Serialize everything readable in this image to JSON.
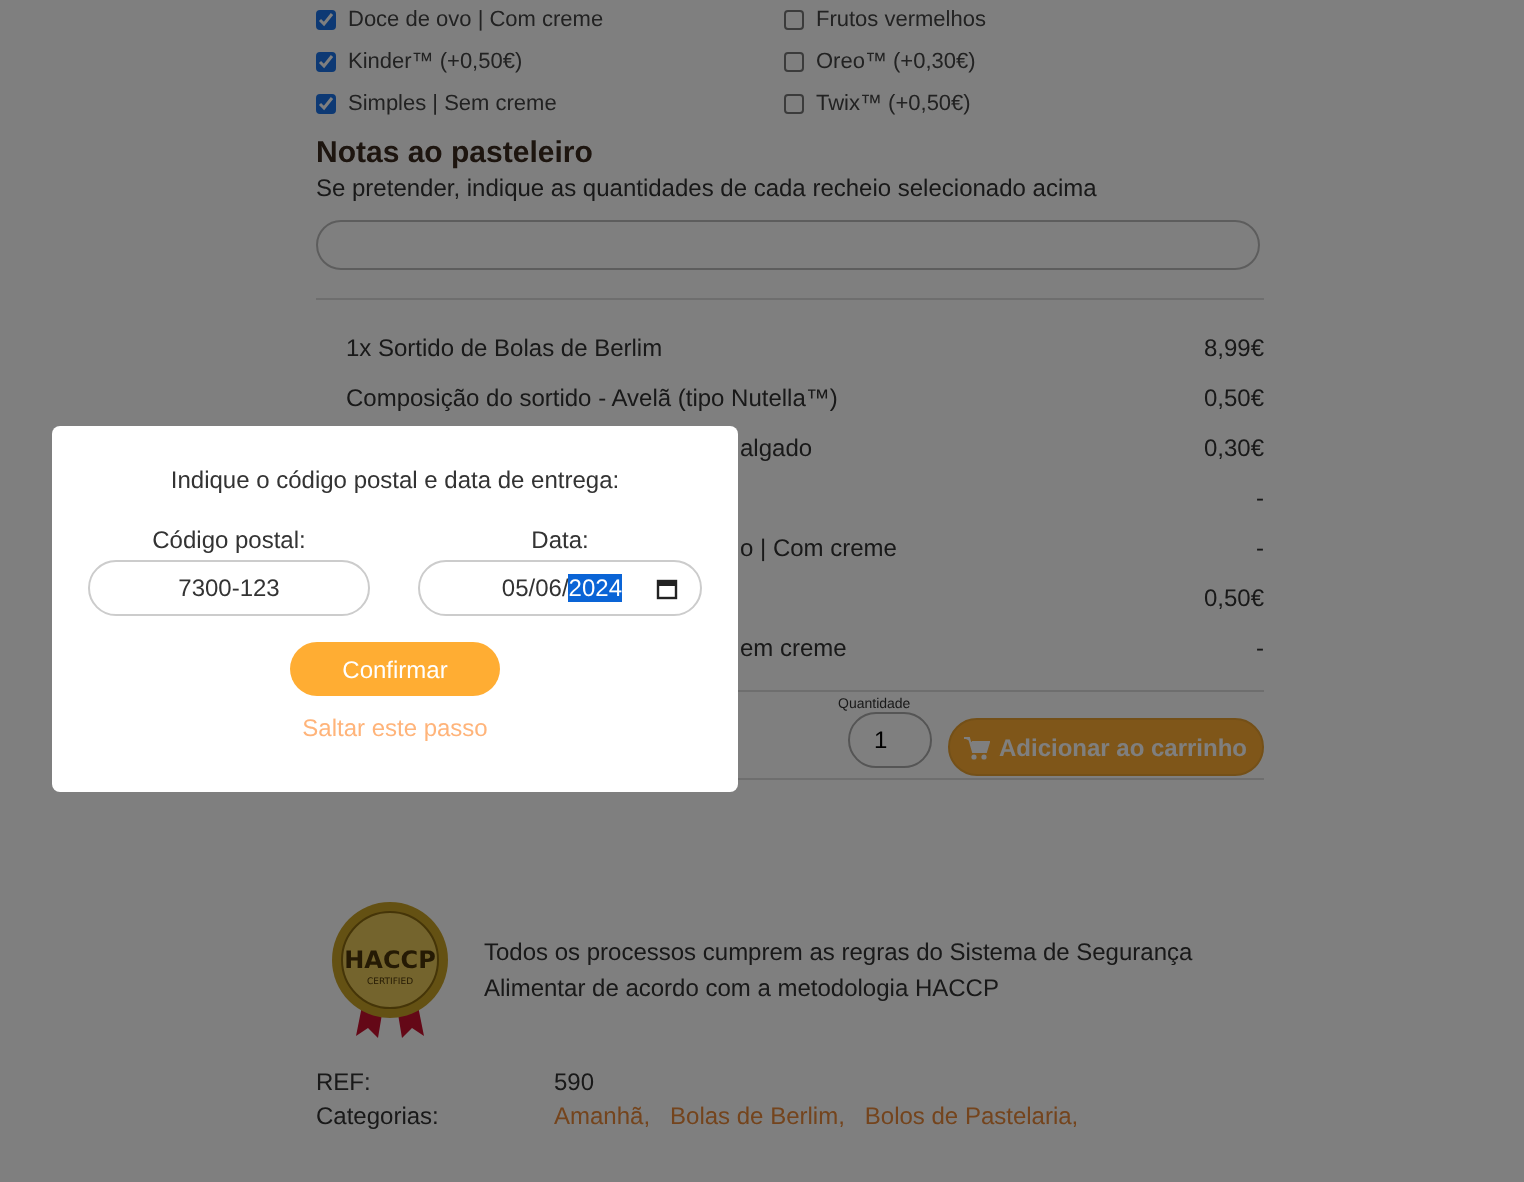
{
  "fillings": [
    {
      "label": "Doce de ovo | Com creme",
      "checked": true
    },
    {
      "label": "Frutos vermelhos",
      "checked": false
    },
    {
      "label": "Kinder™ (+0,50€)",
      "checked": true
    },
    {
      "label": "Oreo™ (+0,30€)",
      "checked": false
    },
    {
      "label": "Simples | Sem creme",
      "checked": true
    },
    {
      "label": "Twix™ (+0,50€)",
      "checked": false
    }
  ],
  "notes": {
    "title": "Notas ao pasteleiro",
    "hint": "Se pretender, indique as quantidades de cada recheio selecionado acima"
  },
  "summary": [
    {
      "label": "1x Sortido de Bolas de Berlim",
      "price": "8,99€",
      "covered": false
    },
    {
      "label": "Composição do sortido - Avelã (tipo Nutella™)",
      "price": "0,50€",
      "covered": false
    },
    {
      "label": "algado",
      "price": "0,30€",
      "covered": true
    },
    {
      "price": "-"
    },
    {
      "label": "o | Com creme",
      "price": "-",
      "covered": true
    },
    {
      "price": "0,50€"
    },
    {
      "label": "em creme",
      "price": "-",
      "covered": true
    }
  ],
  "quantity": {
    "label": "Quantidade",
    "value": "1"
  },
  "add_to_cart": "Adicionar ao carrinho",
  "haccp": {
    "badge_title": "HACCP",
    "badge_sub": "CERTIFIED",
    "text": "Todos os processos cumprem as regras do Sistema de Segurança Alimentar de acordo com a metodologia HACCP"
  },
  "meta": [
    {
      "label": "REF:",
      "value": "590"
    },
    {
      "label": "Categorias:",
      "links": [
        "Amanhã,",
        "Bolas de Berlim,",
        "Bolos de Pastelaria,"
      ]
    }
  ],
  "dialog": {
    "title": "Indique o código postal e data de entrega:",
    "postal": {
      "label": "Código postal:",
      "value": "7300-123"
    },
    "date": {
      "label": "Data:",
      "segments": [
        {
          "text": "05",
          "selected": false
        },
        {
          "text": "/",
          "selected": false
        },
        {
          "text": "06",
          "selected": false
        },
        {
          "text": "/",
          "selected": false
        },
        {
          "text": "2024",
          "selected": true
        }
      ]
    },
    "confirm": "Confirmar",
    "skip": "Saltar este passo"
  }
}
